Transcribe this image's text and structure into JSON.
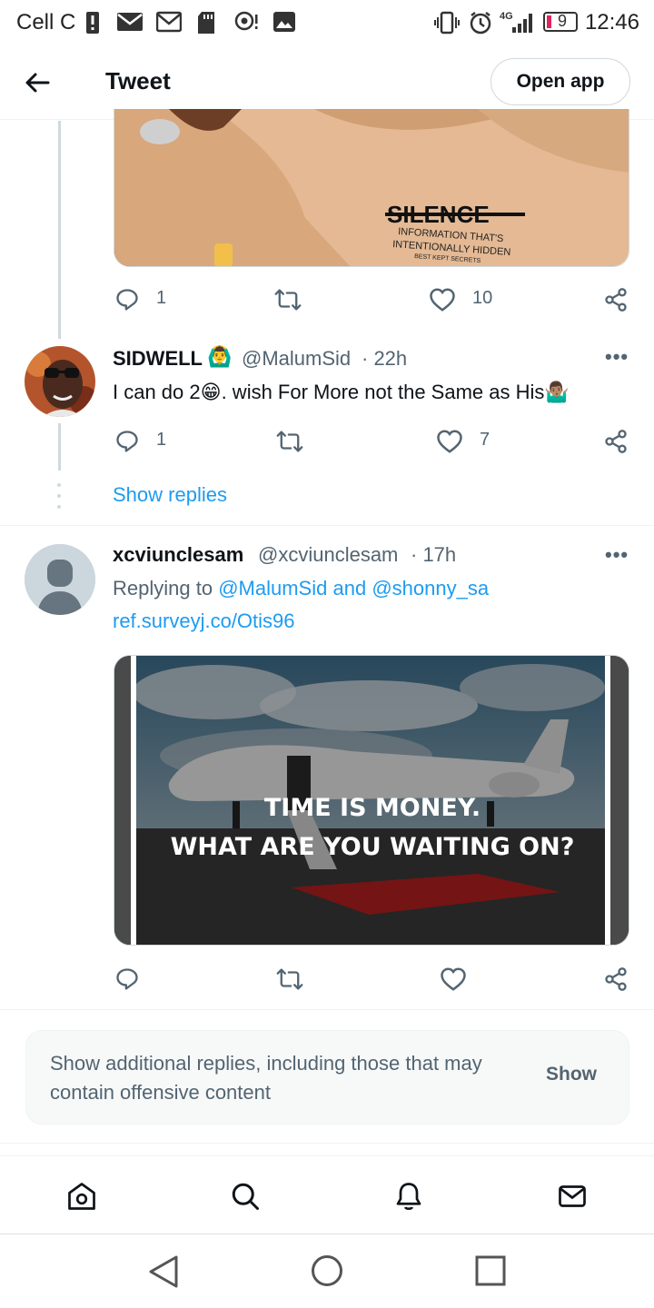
{
  "status_bar": {
    "carrier": "Cell C",
    "network": "4G",
    "battery": "9",
    "time": "12:46"
  },
  "header": {
    "title": "Tweet",
    "open_app_label": "Open app"
  },
  "media_1": {
    "text_lines": [
      "SILENCE",
      "INFORMATION THAT'S",
      "INTENTIONALLY HIDDEN",
      "BEST KEPT SECRETS"
    ]
  },
  "tweet_1_actions": {
    "replies": "1",
    "likes": "10"
  },
  "tweet_2": {
    "name": "SIDWELL",
    "handle": "@MalumSid",
    "time": "· 22h",
    "text_a": "I can do 2",
    "text_b": ". wish For More not the Same as His",
    "replies": "1",
    "likes": "7",
    "show_replies": "Show replies"
  },
  "tweet_3": {
    "name": "xcviunclesam",
    "handle": "@xcviunclesam",
    "time": "· 17h",
    "replying_prefix": "Replying to",
    "reply_user_1": "@MalumSid",
    "reply_and": "and",
    "reply_user_2": "@shonny_sa",
    "link": "ref.surveyj.co/Otis96",
    "media_line_1": "TIME IS MONEY.",
    "media_line_2": "WHAT ARE YOU WAITING ON?"
  },
  "notice": {
    "text": "Show additional replies, including those that may contain offensive content",
    "button": "Show"
  },
  "icons": {
    "reply": "reply-icon",
    "retweet": "retweet-icon",
    "like": "heart-icon",
    "share": "share-icon",
    "home": "home-icon",
    "search": "search-icon",
    "notifications": "bell-icon",
    "messages": "mail-icon"
  },
  "colors": {
    "accent": "#1d9bf0",
    "secondary_text": "#536471",
    "border": "#cfd9de"
  }
}
